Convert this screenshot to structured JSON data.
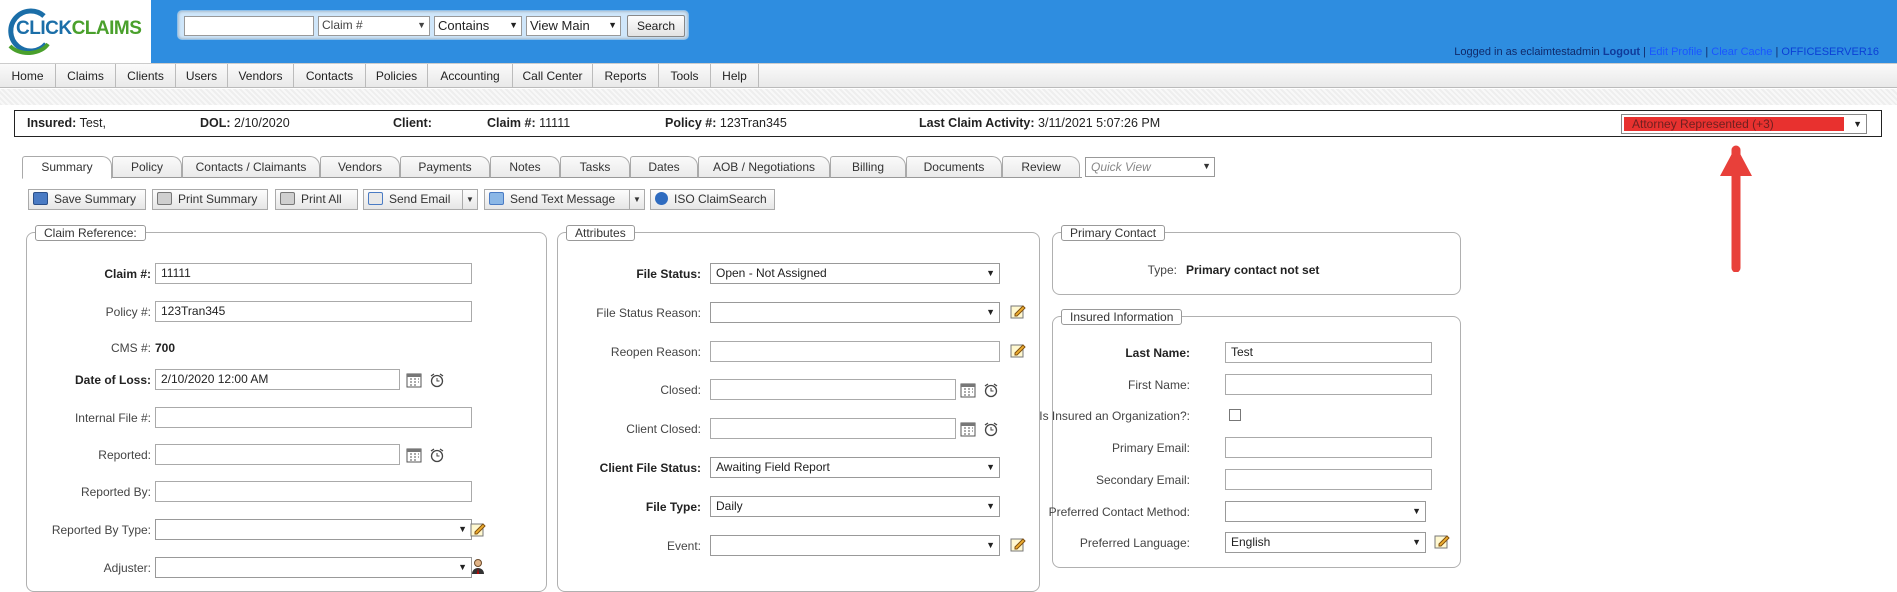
{
  "logo": {
    "part1": "CLICK",
    "part2": "CLAIMS"
  },
  "search": {
    "input_value": "",
    "field_select": "Claim #",
    "match_select": "Contains",
    "view_select": "View Main",
    "button": "Search"
  },
  "login": {
    "prefix": "Logged in as eclaimtestadmin",
    "logout": "Logout",
    "edit_profile": "Edit Profile",
    "clear_cache": "Clear Cache",
    "server": "OFFICESERVER16",
    "sep": "|"
  },
  "menu": [
    "Home",
    "Claims",
    "Clients",
    "Users",
    "Vendors",
    "Contacts",
    "Policies",
    "Accounting",
    "Call Center",
    "Reports",
    "Tools",
    "Help"
  ],
  "infobar": {
    "insured_label": "Insured:",
    "insured_value": "Test,",
    "dol_label": "DOL:",
    "dol_value": "2/10/2020",
    "client_label": "Client:",
    "claim_label": "Claim #:",
    "claim_value": "11111",
    "policy_label": "Policy #:",
    "policy_value": "123Tran345",
    "activity_label": "Last Claim Activity:",
    "activity_value": "3/11/2021 5:07:26 PM",
    "attorney": "Attorney Represented (+3)",
    "attorney_color": "#e8312f"
  },
  "tabs": [
    "Summary",
    "Policy",
    "Contacts / Claimants",
    "Vendors",
    "Payments",
    "Notes",
    "Tasks",
    "Dates",
    "AOB / Negotiations",
    "Billing",
    "Documents",
    "Review"
  ],
  "quick_view": "Quick View",
  "actions": {
    "save_summary": "Save Summary",
    "print_summary": "Print Summary",
    "print_all": "Print All",
    "send_email": "Send Email",
    "send_text": "Send Text Message",
    "iso": "ISO ClaimSearch"
  },
  "claim_ref": {
    "legend": "Claim Reference:",
    "claim_label": "Claim #:",
    "claim_value": "11111",
    "policy_label": "Policy #:",
    "policy_value": "123Tran345",
    "cms_label": "CMS #:",
    "cms_value": "700",
    "dol_label": "Date of Loss:",
    "dol_value": "2/10/2020 12:00 AM",
    "internal_label": "Internal File #:",
    "internal_value": "",
    "reported_label": "Reported:",
    "reported_value": "",
    "reported_by_label": "Reported By:",
    "reported_by_value": "",
    "reported_type_label": "Reported By Type:",
    "reported_type_value": "",
    "adjuster_label": "Adjuster:",
    "adjuster_value": ""
  },
  "attributes": {
    "legend": "Attributes",
    "file_status_label": "File Status:",
    "file_status_value": "Open - Not Assigned",
    "file_status_reason_label": "File Status Reason:",
    "file_status_reason_value": "",
    "reopen_label": "Reopen Reason:",
    "reopen_value": "",
    "closed_label": "Closed:",
    "closed_value": "",
    "client_closed_label": "Client Closed:",
    "client_closed_value": "",
    "client_file_status_label": "Client File Status:",
    "client_file_status_value": "Awaiting Field Report",
    "file_type_label": "File Type:",
    "file_type_value": "Daily",
    "event_label": "Event:",
    "event_value": ""
  },
  "primary_contact": {
    "legend": "Primary Contact",
    "type_label": "Type:",
    "type_value": "Primary contact not set"
  },
  "insured_info": {
    "legend": "Insured Information",
    "last_name_label": "Last Name:",
    "last_name_value": "Test",
    "first_name_label": "First Name:",
    "first_name_value": "",
    "is_org_label": "Is Insured an Organization?:",
    "primary_email_label": "Primary Email:",
    "primary_email_value": "",
    "secondary_email_label": "Secondary Email:",
    "secondary_email_value": "",
    "pref_method_label": "Preferred Contact Method:",
    "pref_method_value": "",
    "pref_lang_label": "Preferred Language:",
    "pref_lang_value": "English"
  },
  "colors": {
    "header_bg": "#2e8de0",
    "arrow": "#e8403a"
  }
}
